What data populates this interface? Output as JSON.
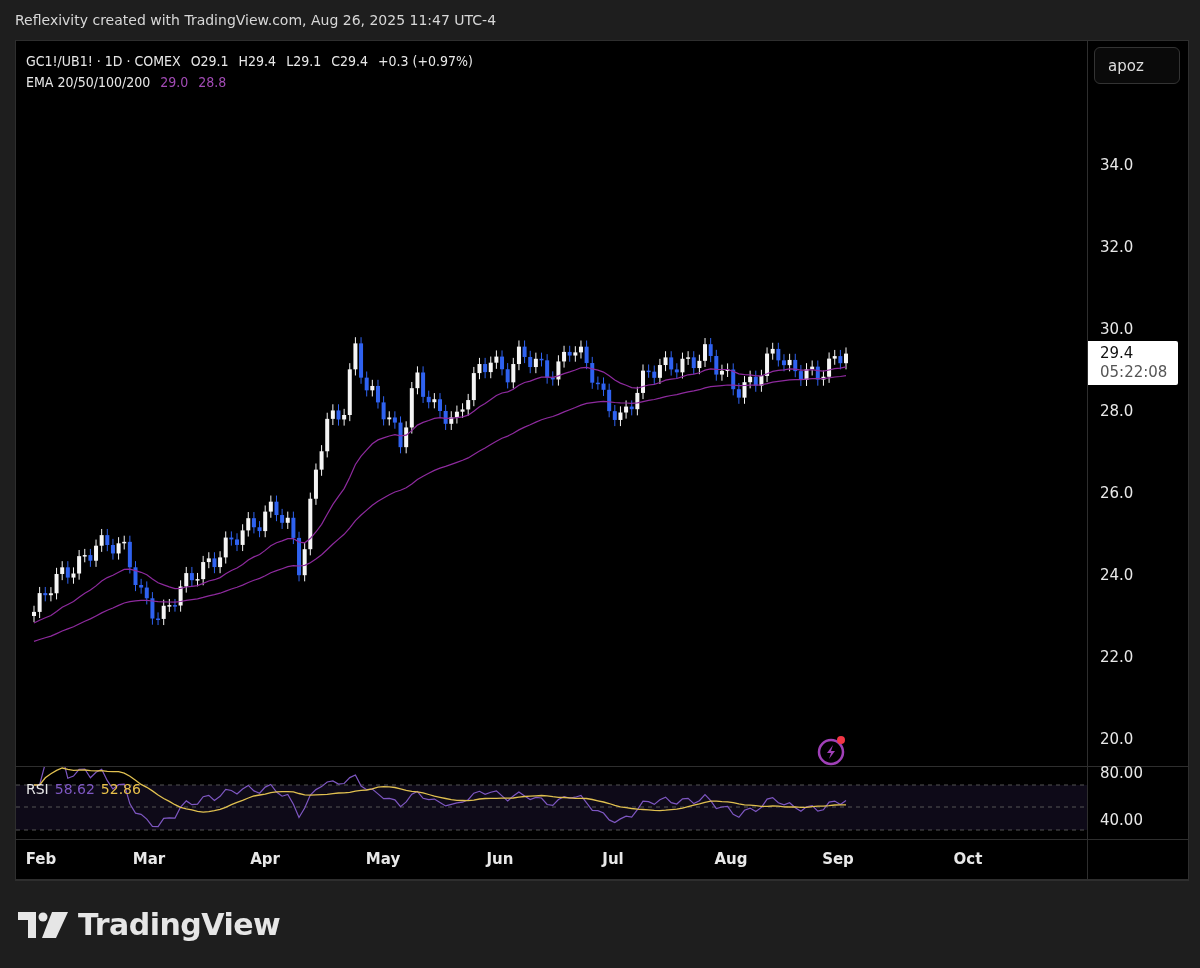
{
  "caption": "Reflexivity created with TradingView.com, Aug 26, 2025 11:47 UTC-4",
  "legend": {
    "symbol": "GC1!/UB1! · 1D · COMEX",
    "ohlc": [
      "O29.1",
      "H29.4",
      "L29.1",
      "C29.4"
    ],
    "change": "+0.3 (+0.97%)",
    "ema_label": "EMA 20/50/100/200",
    "ema_values": [
      "29.0",
      "28.8"
    ]
  },
  "account_button": "apoz",
  "price_axis": {
    "ticks": [
      "34.0",
      "32.0",
      "30.0",
      "28.0",
      "26.0",
      "24.0",
      "22.0",
      "20.0"
    ],
    "last_price": "29.4",
    "countdown": "05:22:08"
  },
  "alert_icon": {
    "unread": true
  },
  "rsi": {
    "label": "RSI",
    "value": "58.62",
    "ma_value": "52.86",
    "ticks": [
      "80.00",
      "40.00"
    ]
  },
  "time_axis": {
    "ticks": [
      "Feb",
      "Mar",
      "Apr",
      "May",
      "Jun",
      "Jul",
      "Aug",
      "Sep",
      "Oct"
    ]
  },
  "brand": "TradingView"
}
